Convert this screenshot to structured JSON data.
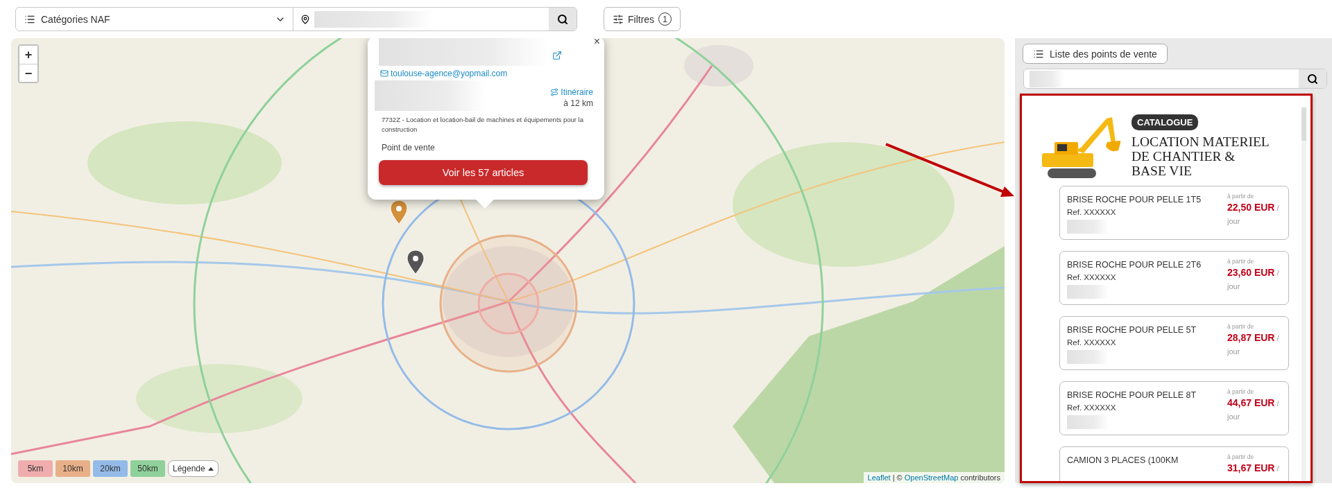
{
  "search_bar": {
    "category_select": {
      "label": "Catégories NAF"
    }
  },
  "filters_button": {
    "label": "Filtres",
    "count": "1"
  },
  "map": {
    "zoom": {
      "in": "+",
      "out": "−"
    },
    "popup": {
      "close": "×",
      "email": "toulouse-agence@yopmail.com",
      "route_link": "Itinéraire",
      "distance": "à 12 km",
      "activity": "7732Z - Location et location-bail de machines et équipements pour la construction",
      "type": "Point de vente",
      "button": "Voir les 57 articles"
    },
    "legend": [
      {
        "label": "5km",
        "color": "#f0adad"
      },
      {
        "label": "10km",
        "color": "#e8b088"
      },
      {
        "label": "20km",
        "color": "#94bbe8"
      },
      {
        "label": "50km",
        "color": "#8fd19a"
      }
    ],
    "legend_toggle": "Légende",
    "attribution": {
      "leaflet_link": "Leaflet",
      "separator": "| ©",
      "osm_link": "OpenStreetMap",
      "suffix": "contributors"
    }
  },
  "panel": {
    "list_button": "Liste des points de vente",
    "catalogue": {
      "badge": "CATALOGUE",
      "title": "LOCATION MATERIEL DE CHANTIER & BASE VIE",
      "products": [
        {
          "name": "BRISE ROCHE POUR PELLE 1T5",
          "ref": "Ref. XXXXXX",
          "from": "à partir de",
          "price": "22,50 EUR",
          "per": "/",
          "unit": "jour"
        },
        {
          "name": "BRISE ROCHE POUR PELLE 2T6",
          "ref": "Ref. XXXXXX",
          "from": "à partir de",
          "price": "23,60 EUR",
          "per": "/",
          "unit": "jour"
        },
        {
          "name": "BRISE ROCHE POUR PELLE 5T",
          "ref": "Ref. XXXXXX",
          "from": "à partir de",
          "price": "28,87 EUR",
          "per": "/",
          "unit": "jour"
        },
        {
          "name": "BRISE ROCHE POUR PELLE 8T",
          "ref": "Ref. XXXXXX",
          "from": "à partir de",
          "price": "44,67 EUR",
          "per": "/",
          "unit": "jour"
        },
        {
          "name": "CAMION 3 PLACES (100KM",
          "from": "à partir de",
          "price": "31,67 EUR",
          "per": "/"
        }
      ]
    }
  }
}
